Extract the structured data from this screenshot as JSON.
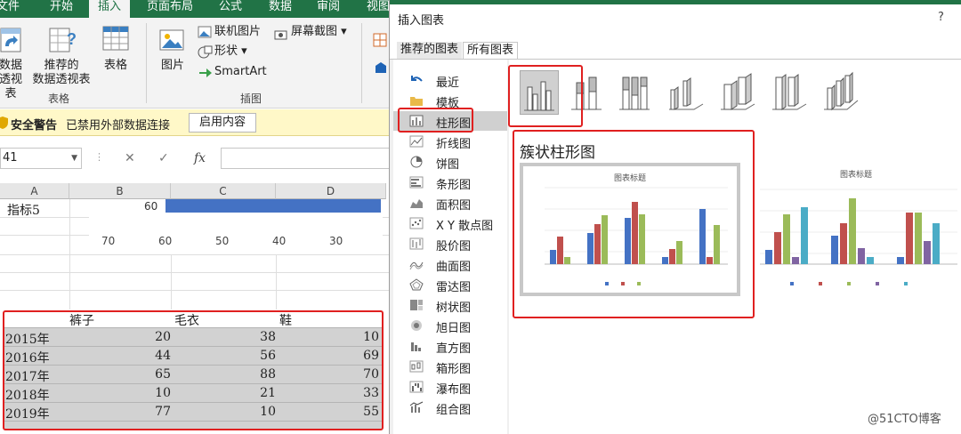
{
  "ribbon": {
    "tabs": [
      "文件",
      "开始",
      "插入",
      "页面布局",
      "公式",
      "数据",
      "审阅",
      "视图"
    ],
    "active_tab": "插入",
    "buttons": {
      "pivot": [
        "数据",
        "透视表"
      ],
      "recommended_pivot": [
        "推荐的",
        "数据透视表"
      ],
      "table": "表格",
      "pictures": "图片",
      "online_pictures": "联机图片",
      "shapes": "形状 ▾",
      "smartart": "SmartArt",
      "screenshot": "屏幕截图 ▾"
    },
    "groups": {
      "tables": "表格",
      "illustrations": "插图"
    }
  },
  "security_bar": {
    "title": "安全警告",
    "message": "已禁用外部数据连接",
    "enable_button": "启用内容"
  },
  "formula_bar": {
    "name_box": "41",
    "cancel": "✕",
    "enter": "✓",
    "fx": "fx"
  },
  "sheet": {
    "columns": [
      "A",
      "B",
      "C",
      "D"
    ],
    "cell_a": "指标5",
    "bar_value": "60",
    "axis_ticks": [
      "70",
      "60",
      "50",
      "40",
      "30"
    ],
    "table": {
      "header": [
        "",
        "裤子",
        "毛衣",
        "鞋"
      ],
      "rows": [
        [
          "2015年",
          "20",
          "38",
          "10"
        ],
        [
          "2016年",
          "44",
          "56",
          "69"
        ],
        [
          "2017年",
          "65",
          "88",
          "70"
        ],
        [
          "2018年",
          "10",
          "21",
          "33"
        ],
        [
          "2019年",
          "77",
          "10",
          "55"
        ]
      ]
    }
  },
  "dialog": {
    "title": "插入图表",
    "help": "?",
    "tabs": [
      "推荐的图表",
      "所有图表"
    ],
    "active_tab": "所有图表",
    "chart_types": [
      "最近",
      "模板",
      "柱形图",
      "折线图",
      "饼图",
      "条形图",
      "面积图",
      "X Y 散点图",
      "股价图",
      "曲面图",
      "雷达图",
      "树状图",
      "旭日图",
      "直方图",
      "箱形图",
      "瀑布图",
      "组合图"
    ],
    "selected_type": "柱形图",
    "subtype_title": "簇状柱形图",
    "preview_title": "图表标题"
  },
  "watermark": "@51CTO博客",
  "colors": {
    "excel_green": "#217346",
    "series_blue": "#4472c4",
    "series_red": "#c0504d",
    "series_green": "#9bbb59",
    "series_purple": "#8064a2",
    "series_teal": "#4bacc6",
    "highlight_red": "#e02020"
  }
}
